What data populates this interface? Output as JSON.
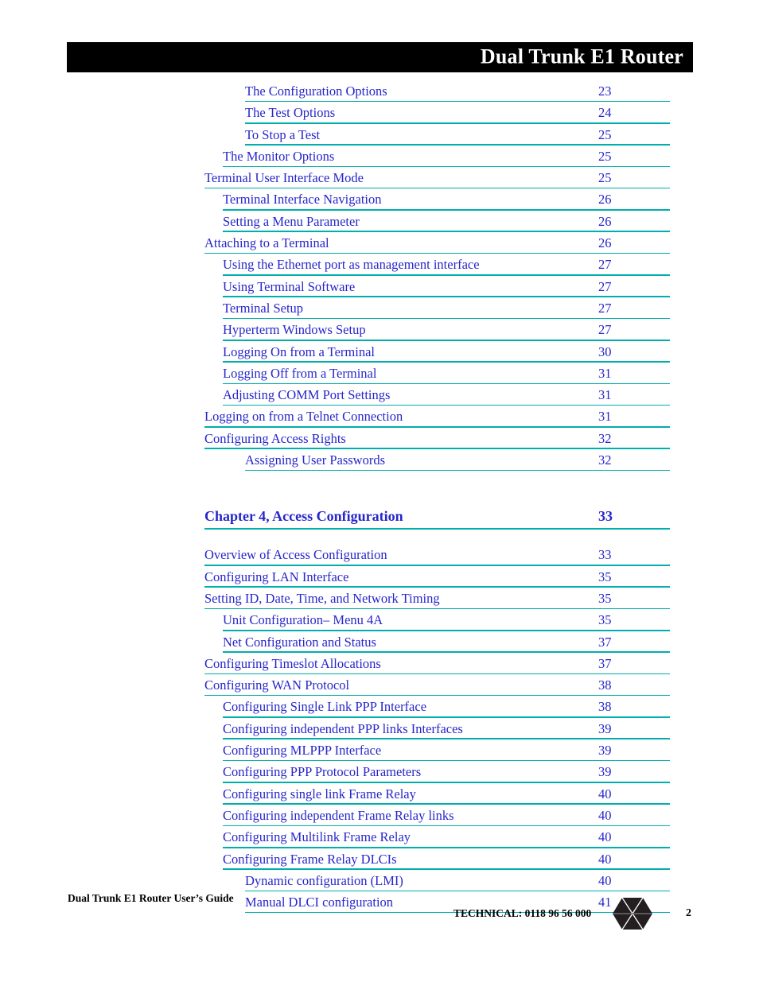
{
  "header": {
    "title": "Dual Trunk E1 Router"
  },
  "toc": {
    "entries": [
      {
        "label": "The Configuration Options",
        "page": "23",
        "level": 2,
        "chapter": false
      },
      {
        "label": "The Test Options",
        "page": "24",
        "level": 2,
        "chapter": false
      },
      {
        "label": "To Stop a Test",
        "page": "25",
        "level": 2,
        "chapter": false
      },
      {
        "label": "The Monitor Options",
        "page": "25",
        "level": 1,
        "chapter": false
      },
      {
        "label": "Terminal User Interface Mode",
        "page": "25",
        "level": 0,
        "chapter": false
      },
      {
        "label": "Terminal Interface Navigation",
        "page": "26",
        "level": 1,
        "chapter": false
      },
      {
        "label": "Setting a Menu Parameter",
        "page": "26",
        "level": 1,
        "chapter": false
      },
      {
        "label": "Attaching to a Terminal",
        "page": "26",
        "level": 0,
        "chapter": false
      },
      {
        "label": "Using the Ethernet port as management interface",
        "page": "27",
        "level": 1,
        "chapter": false
      },
      {
        "label": "Using Terminal Software",
        "page": "27",
        "level": 1,
        "chapter": false
      },
      {
        "label": "Terminal Setup",
        "page": "27",
        "level": 1,
        "chapter": false
      },
      {
        "label": "Hyperterm Windows Setup",
        "page": "27",
        "level": 1,
        "chapter": false
      },
      {
        "label": "Logging On from a Terminal",
        "page": "30",
        "level": 1,
        "chapter": false
      },
      {
        "label": "Logging Off from a Terminal",
        "page": "31",
        "level": 1,
        "chapter": false
      },
      {
        "label": "Adjusting COMM Port Settings",
        "page": "31",
        "level": 1,
        "chapter": false
      },
      {
        "label": "Logging on from a Telnet Connection",
        "page": "31",
        "level": 0,
        "chapter": false
      },
      {
        "label": "Configuring Access Rights",
        "page": "32",
        "level": 0,
        "chapter": false
      },
      {
        "label": "Assigning User Passwords",
        "page": "32",
        "level": 2,
        "chapter": false
      },
      {
        "label": "Chapter 4, Access Configuration",
        "page": "33",
        "level": 0,
        "chapter": true
      },
      {
        "label": "Overview of Access Configuration",
        "page": "33",
        "level": 0,
        "chapter": false
      },
      {
        "label": "Configuring LAN Interface",
        "page": "35",
        "level": 0,
        "chapter": false
      },
      {
        "label": "Setting ID, Date, Time, and Network Timing",
        "page": "35",
        "level": 0,
        "chapter": false
      },
      {
        "label": "Unit Configuration– Menu 4A",
        "page": "35",
        "level": 1,
        "chapter": false
      },
      {
        "label": "Net Configuration and Status",
        "page": "37",
        "level": 1,
        "chapter": false
      },
      {
        "label": "Configuring Timeslot Allocations",
        "page": "37",
        "level": 0,
        "chapter": false
      },
      {
        "label": "Configuring WAN Protocol",
        "page": "38",
        "level": 0,
        "chapter": false
      },
      {
        "label": "Configuring Single Link PPP Interface",
        "page": "38",
        "level": 1,
        "chapter": false
      },
      {
        "label": "Configuring independent PPP links Interfaces",
        "page": "39",
        "level": 1,
        "chapter": false
      },
      {
        "label": "Configuring MLPPP Interface",
        "page": "39",
        "level": 1,
        "chapter": false
      },
      {
        "label": "Configuring PPP Protocol Parameters",
        "page": "39",
        "level": 1,
        "chapter": false
      },
      {
        "label": "Configuring single link Frame Relay",
        "page": "40",
        "level": 1,
        "chapter": false
      },
      {
        "label": "Configuring independent Frame Relay links",
        "page": "40",
        "level": 1,
        "chapter": false
      },
      {
        "label": "Configuring Multilink Frame Relay",
        "page": "40",
        "level": 1,
        "chapter": false
      },
      {
        "label": "Configuring Frame Relay DLCIs",
        "page": "40",
        "level": 1,
        "chapter": false
      },
      {
        "label": "Dynamic configuration (LMI)",
        "page": "40",
        "level": 2,
        "chapter": false
      },
      {
        "label": "Manual DLCI configuration",
        "page": "41",
        "level": 2,
        "chapter": false
      }
    ]
  },
  "footer": {
    "guide_title": "Dual Trunk E1 Router User’s Guide",
    "technical": "TECHNICAL:  0118 96 56 000",
    "page_number": "2",
    "logo_name": "hexagon-diamond-logo"
  },
  "colors": {
    "link_blue": "#2626cc",
    "rule_teal": "#00aeae",
    "header_black": "#000000",
    "header_text": "#ffffff"
  }
}
